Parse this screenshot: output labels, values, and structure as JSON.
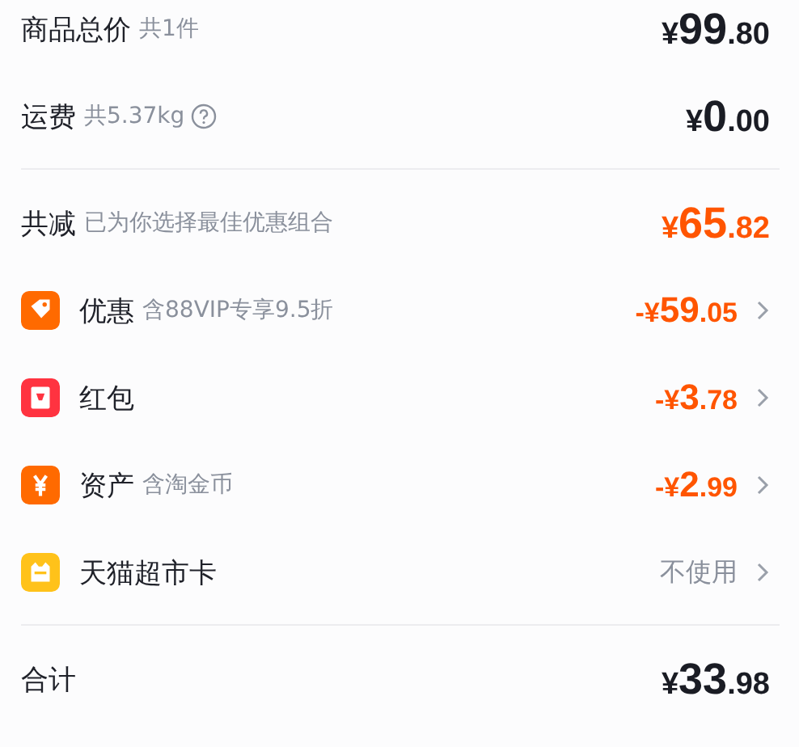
{
  "summary": [
    {
      "label": "商品总价",
      "note": "共1件",
      "help": false,
      "amount": {
        "sign": "¥",
        "integer": "99",
        "decimal": ".80"
      },
      "highlight": false
    },
    {
      "label": "运费",
      "note": "共5.37kg",
      "help": true,
      "amount": {
        "sign": "¥",
        "integer": "0",
        "decimal": ".00"
      },
      "highlight": false
    }
  ],
  "savings": {
    "label": "共减",
    "note": "已为你选择最佳优惠组合",
    "amount": {
      "sign": "¥",
      "integer": "65",
      "decimal": ".82"
    },
    "highlight": true
  },
  "discounts": [
    {
      "kind": "tag",
      "label": "优惠",
      "note": "含88VIP专享9.5折",
      "amount": {
        "sign": "-¥",
        "integer": "59",
        "decimal": ".05"
      }
    },
    {
      "kind": "packet",
      "label": "红包",
      "amount": {
        "sign": "-¥",
        "integer": "3",
        "decimal": ".78"
      }
    },
    {
      "kind": "yen",
      "label": "资产",
      "note": "含淘金币",
      "amount": {
        "sign": "-¥",
        "integer": "2",
        "decimal": ".99"
      }
    },
    {
      "kind": "card",
      "label": "天猫超市卡",
      "option": "不使用"
    }
  ],
  "total": {
    "label": "合计",
    "amount": {
      "sign": "¥",
      "integer": "33",
      "decimal": ".98"
    },
    "highlight": false
  }
}
